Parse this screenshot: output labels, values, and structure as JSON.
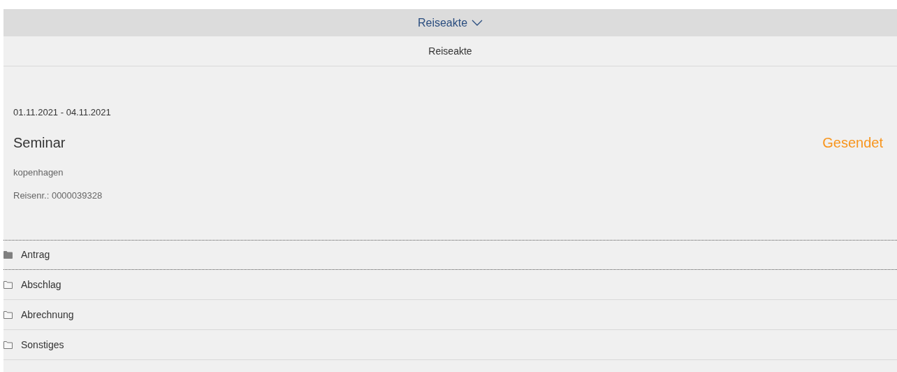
{
  "shell_title": "Reiseakte",
  "page_title": "Reiseakte",
  "trip": {
    "dates": "01.11.2021 - 04.11.2021",
    "title": "Seminar",
    "status": "Gesendet",
    "location": "kopenhagen",
    "number": "Reisenr.: 0000039328"
  },
  "folders": [
    {
      "label": "Antrag",
      "selected": true
    },
    {
      "label": "Abschlag",
      "selected": false
    },
    {
      "label": "Abrechnung",
      "selected": false
    },
    {
      "label": "Sonstiges",
      "selected": false
    }
  ]
}
